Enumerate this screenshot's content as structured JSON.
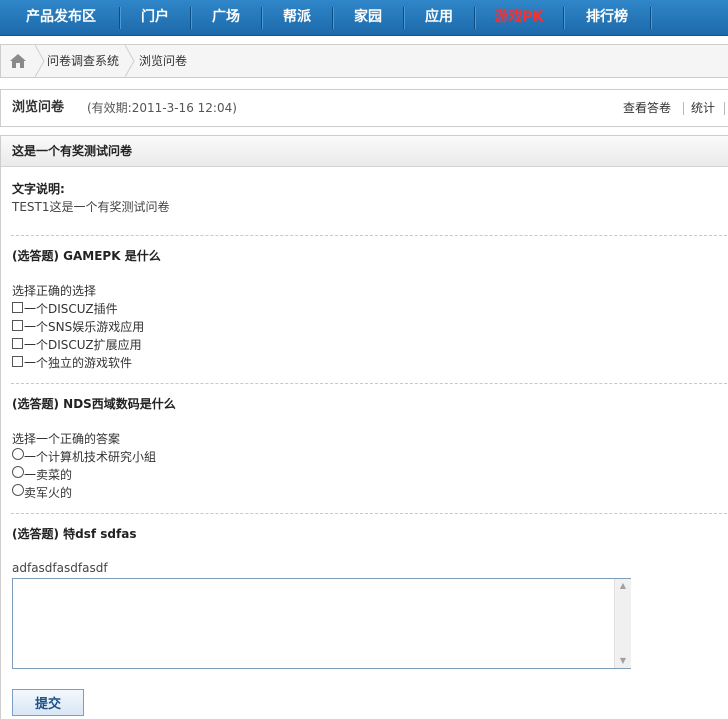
{
  "nav": {
    "items": [
      "产品发布区",
      "门户",
      "广场",
      "帮派",
      "家园",
      "应用",
      "游戏PK",
      "排行榜"
    ]
  },
  "breadcrumb": {
    "items": [
      "问卷调查系统",
      "浏览问卷"
    ],
    "home_icon": "home-icon"
  },
  "header": {
    "title": "浏览问卷",
    "validity": "(有效期:2011-3-16 12:04)",
    "links": [
      "查看答卷",
      "统计"
    ]
  },
  "survey": {
    "title": "这是一个有奖测试问卷",
    "desc_label": "文字说明:",
    "desc_text": "TEST1这是一个有奖测试问卷",
    "questions": [
      {
        "title": "(选答题) GAMEPK 是什么",
        "prompt": "选择正确的选择",
        "type": "checkbox",
        "options": [
          "一个DISCUZ插件",
          "一个SNS娱乐游戏应用",
          "一个DISCUZ扩展应用",
          "一个独立的游戏软件"
        ]
      },
      {
        "title": "(选答题) NDS西域数码是什么",
        "prompt": "选择一个正确的答案",
        "type": "radio",
        "options": [
          "一个计算机技术研究小組",
          "一卖菜的",
          "卖军火的"
        ]
      },
      {
        "title": "(选答题) 特dsf sdfas",
        "prompt": "adfasdfasdfasdf",
        "type": "text",
        "value": ""
      }
    ]
  },
  "submit_label": "提交",
  "colors": {
    "nav_bg": "#1d6aab",
    "nav_hot": "#ff2d2d",
    "button_text": "#1e4f87"
  }
}
